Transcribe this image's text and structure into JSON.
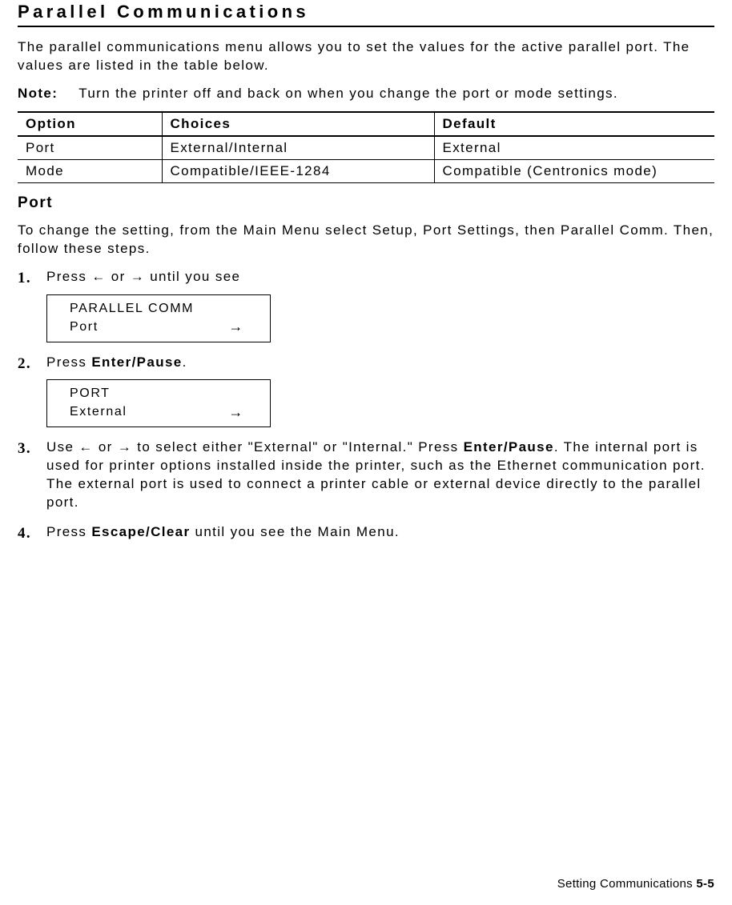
{
  "heading": "Parallel Communications",
  "intro": "The parallel communications menu allows you to set the values for the active parallel port.  The values are listed in the table below.",
  "note": {
    "label": "Note:",
    "text": "Turn the printer off and back on when you change the port or mode settings."
  },
  "table": {
    "headers": [
      "Option",
      "Choices",
      "Default"
    ],
    "rows": [
      [
        "Port",
        "External/Internal",
        "External"
      ],
      [
        "Mode",
        "Compatible/IEEE-1284",
        "Compatible (Centronics mode)"
      ]
    ]
  },
  "port": {
    "title": "Port",
    "intro": "To change the setting, from the Main Menu select Setup, Port Settings, then Parallel Comm.  Then, follow these steps."
  },
  "steps": {
    "s1": {
      "pre": "Press ",
      "mid": " or ",
      "post": " until you see",
      "arrowLeft": "←",
      "arrowRight": "→",
      "lcd": {
        "line1": "PARALLEL COMM",
        "line2": "Port",
        "arrow": "→"
      }
    },
    "s2": {
      "pre": "Press ",
      "key": "Enter/Pause",
      "post": ".",
      "lcd": {
        "line1": "PORT",
        "line2": "External",
        "arrow": "→"
      }
    },
    "s3": {
      "pre": "Use ",
      "arrowLeft": "←",
      "mid": " or ",
      "arrowRight": "→",
      "post1": " to select either \"External\" or \"Internal.\"  Press ",
      "key": "Enter/Pause",
      "post2": ". The internal port is used for printer options installed inside the printer, such as the Ethernet communication port.  The external port is used to connect a printer cable or external device directly to the parallel port."
    },
    "s4": {
      "pre": "Press ",
      "key": "Escape/Clear",
      "post": " until you see the Main Menu."
    }
  },
  "footer": {
    "text": "Setting Communications  ",
    "page": "5-5"
  }
}
